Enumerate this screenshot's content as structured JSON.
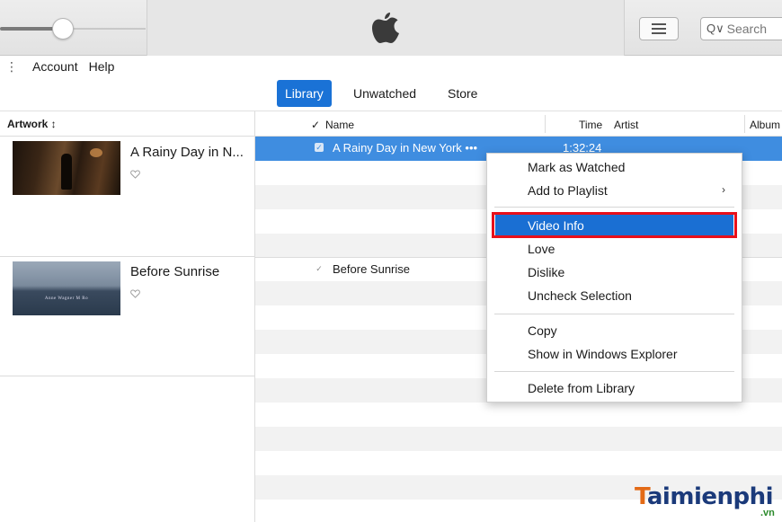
{
  "toolbar": {
    "search_placeholder": "Search",
    "search_prefix": "Q∨"
  },
  "menubar": {
    "items": [
      "Account",
      "Help"
    ]
  },
  "tabs": [
    {
      "label": "Library",
      "active": true
    },
    {
      "label": "Unwatched",
      "active": false
    },
    {
      "label": "Store",
      "active": false
    }
  ],
  "artwork": {
    "header": "Artwork ↕",
    "items": [
      {
        "title": "A Rainy Day in N..."
      },
      {
        "title": "Before Sunrise",
        "poster_text": "Anne Wagner M Ro"
      }
    ]
  },
  "list": {
    "headers": {
      "check": "✓",
      "name": "Name",
      "time": "Time",
      "artist": "Artist",
      "album": "Album"
    },
    "rows": [
      {
        "name": "A Rainy Day in New York •••",
        "time": "1:32:24",
        "checked": true,
        "selected": true
      },
      {
        "name": "Before Sunrise",
        "time": "",
        "checked": true,
        "selected": false
      }
    ]
  },
  "context_menu": {
    "items": [
      {
        "label": "Mark as Watched"
      },
      {
        "label": "Add to Playlist",
        "submenu": "›"
      },
      {
        "label": "Video Info",
        "highlighted": true
      },
      {
        "label": "Love"
      },
      {
        "label": "Dislike"
      },
      {
        "label": "Uncheck Selection"
      },
      {
        "label": "Copy"
      },
      {
        "label": "Show in Windows Explorer"
      },
      {
        "label": "Delete from Library"
      }
    ]
  },
  "watermark": {
    "first": "T",
    "rest": "aimienphi",
    "sub": ".vn"
  },
  "colors": {
    "accent": "#1a72d6",
    "selection": "#3f8de0",
    "highlight_box": "#e8101a"
  }
}
